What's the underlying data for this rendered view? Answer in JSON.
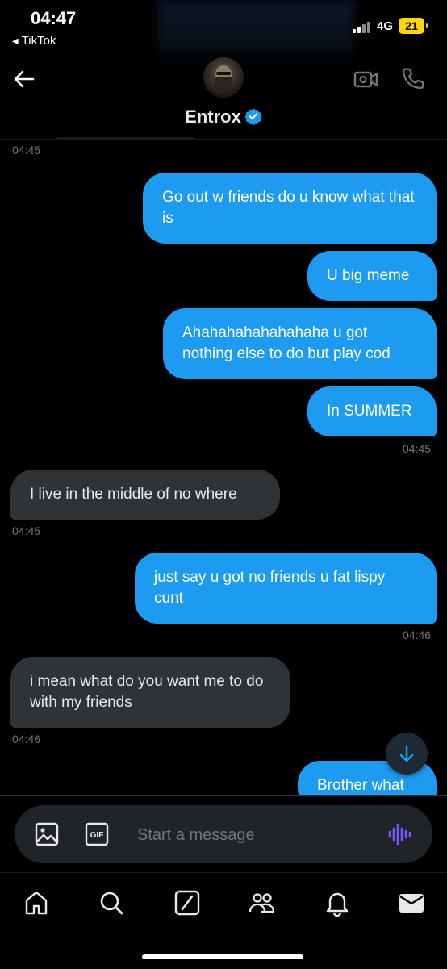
{
  "status_bar": {
    "time": "04:47",
    "back_app": "TikTok",
    "network": "4G",
    "battery": "21"
  },
  "header": {
    "contact_name": "Entrox",
    "verified": true,
    "icons": [
      "back-arrow-icon",
      "video-camera-icon",
      "phone-icon",
      "verified-badge-icon"
    ]
  },
  "messages": [
    {
      "text": "",
      "timestamp": "04:45"
    },
    {
      "direction": "sent",
      "text": "Go out w friends do u know what that is"
    },
    {
      "direction": "sent",
      "text": "U big meme"
    },
    {
      "direction": "sent",
      "text": "Ahahahahahahahaha u got nothing else to do but play cod"
    },
    {
      "direction": "sent",
      "text": "In SUMMER",
      "timestamp": "04:45"
    },
    {
      "direction": "received",
      "text": "I live in the middle of no where",
      "timestamp": "04:45"
    },
    {
      "direction": "sent",
      "text": "just say u got no friends u fat lispy cunt",
      "timestamp": "04:46"
    },
    {
      "direction": "received",
      "text": "i mean what do you want me to do with my friends",
      "timestamp": "04:46"
    },
    {
      "direction": "sent",
      "text": "Brother what"
    }
  ],
  "composer": {
    "placeholder": "Start a message",
    "gif_label": "GIF"
  },
  "colors": {
    "sent_bubble": "#1d9bf0",
    "received_bubble": "#2f3336",
    "background": "#000000",
    "timestamp": "#71767b",
    "voice_accent": "#7856ff",
    "battery": "#ffd60a"
  },
  "tab_bar": {
    "tabs": [
      "home-icon",
      "search-icon",
      "grok-icon",
      "communities-icon",
      "notifications-icon",
      "messages-icon"
    ],
    "active": "messages-icon"
  }
}
